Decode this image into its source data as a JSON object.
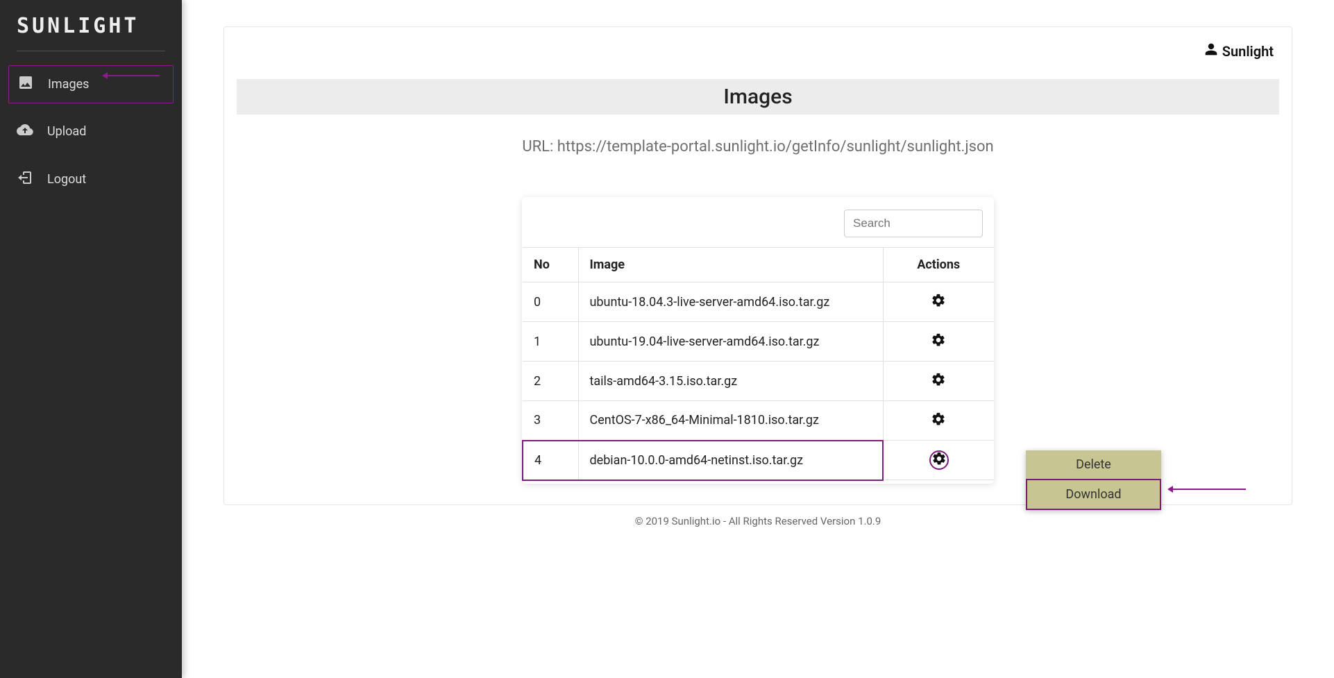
{
  "brand": "SUNLIGHT",
  "sidebar": {
    "items": [
      {
        "label": "Images"
      },
      {
        "label": "Upload"
      },
      {
        "label": "Logout"
      }
    ]
  },
  "header": {
    "user": "Sunlight"
  },
  "page": {
    "title": "Images",
    "url_label": "URL: https://template-portal.sunlight.io/getInfo/sunlight/sunlight.json"
  },
  "search": {
    "placeholder": "Search",
    "value": ""
  },
  "table": {
    "columns": {
      "no": "No",
      "image": "Image",
      "actions": "Actions"
    },
    "rows": [
      {
        "no": "0",
        "image": "ubuntu-18.04.3-live-server-amd64.iso.tar.gz"
      },
      {
        "no": "1",
        "image": "ubuntu-19.04-live-server-amd64.iso.tar.gz"
      },
      {
        "no": "2",
        "image": "tails-amd64-3.15.iso.tar.gz"
      },
      {
        "no": "3",
        "image": "CentOS-7-x86_64-Minimal-1810.iso.tar.gz"
      },
      {
        "no": "4",
        "image": "debian-10.0.0-amd64-netinst.iso.tar.gz"
      }
    ]
  },
  "context_menu": {
    "delete": "Delete",
    "download": "Download"
  },
  "footer": "© 2019 Sunlight.io - All Rights Reserved Version 1.0.9"
}
